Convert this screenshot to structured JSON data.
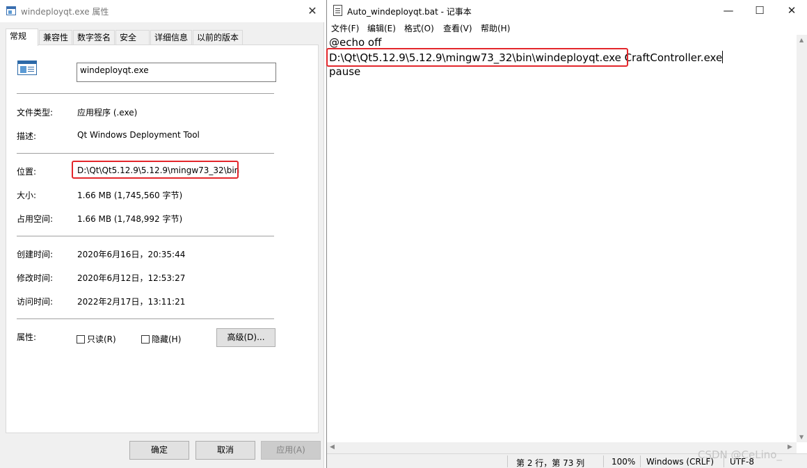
{
  "properties_dialog": {
    "title": "windeployqt.exe 属性",
    "close_glyph": "✕",
    "tabs": [
      "常规",
      "兼容性",
      "数字签名",
      "安全",
      "详细信息",
      "以前的版本"
    ],
    "file_name": "windeployqt.exe",
    "fields": [
      {
        "label": "文件类型:",
        "value": "应用程序 (.exe)"
      },
      {
        "label": "描述:",
        "value": "Qt Windows Deployment Tool"
      },
      {
        "label": "位置:",
        "value": "D:\\Qt\\Qt5.12.9\\5.12.9\\mingw73_32\\bin"
      },
      {
        "label": "大小:",
        "value": "1.66 MB (1,745,560 字节)"
      },
      {
        "label": "占用空间:",
        "value": "1.66 MB (1,748,992 字节)"
      },
      {
        "label": "创建时间:",
        "value": "2020年6月16日，20:35:44"
      },
      {
        "label": "修改时间:",
        "value": "2020年6月12日，12:53:27"
      },
      {
        "label": "访问时间:",
        "value": "2022年2月17日，13:11:21"
      }
    ],
    "attributes_label": "属性:",
    "readonly_label": "只读(R)",
    "hidden_label": "隐藏(H)",
    "advanced_button": "高级(D)...",
    "ok_button": "确定",
    "cancel_button": "取消",
    "apply_button": "应用(A)"
  },
  "notepad": {
    "title": "Auto_windeployqt.bat - 记事本",
    "controls": {
      "minimize": "—",
      "maximize": "☐",
      "close": "✕"
    },
    "menus": [
      "文件(F)",
      "编辑(E)",
      "格式(O)",
      "查看(V)",
      "帮助(H)"
    ],
    "lines": {
      "line1": "@echo off",
      "line2_path": "D:\\Qt\\Qt5.12.9\\5.12.9\\mingw73_32\\bin\\windeployqt.exe",
      "line2_arg": " CraftController.exe",
      "line3": "pause"
    },
    "status": {
      "position": "第 2 行，第 73 列",
      "zoom": "100%",
      "line_ending": "Windows (CRLF)",
      "encoding": "UTF-8"
    },
    "scroll_arrows": {
      "up": "▲",
      "down": "▼",
      "left": "◀",
      "right": "▶"
    }
  },
  "watermark": "CSDN @CeLino_",
  "colors": {
    "highlight_box": "#e3262b"
  }
}
